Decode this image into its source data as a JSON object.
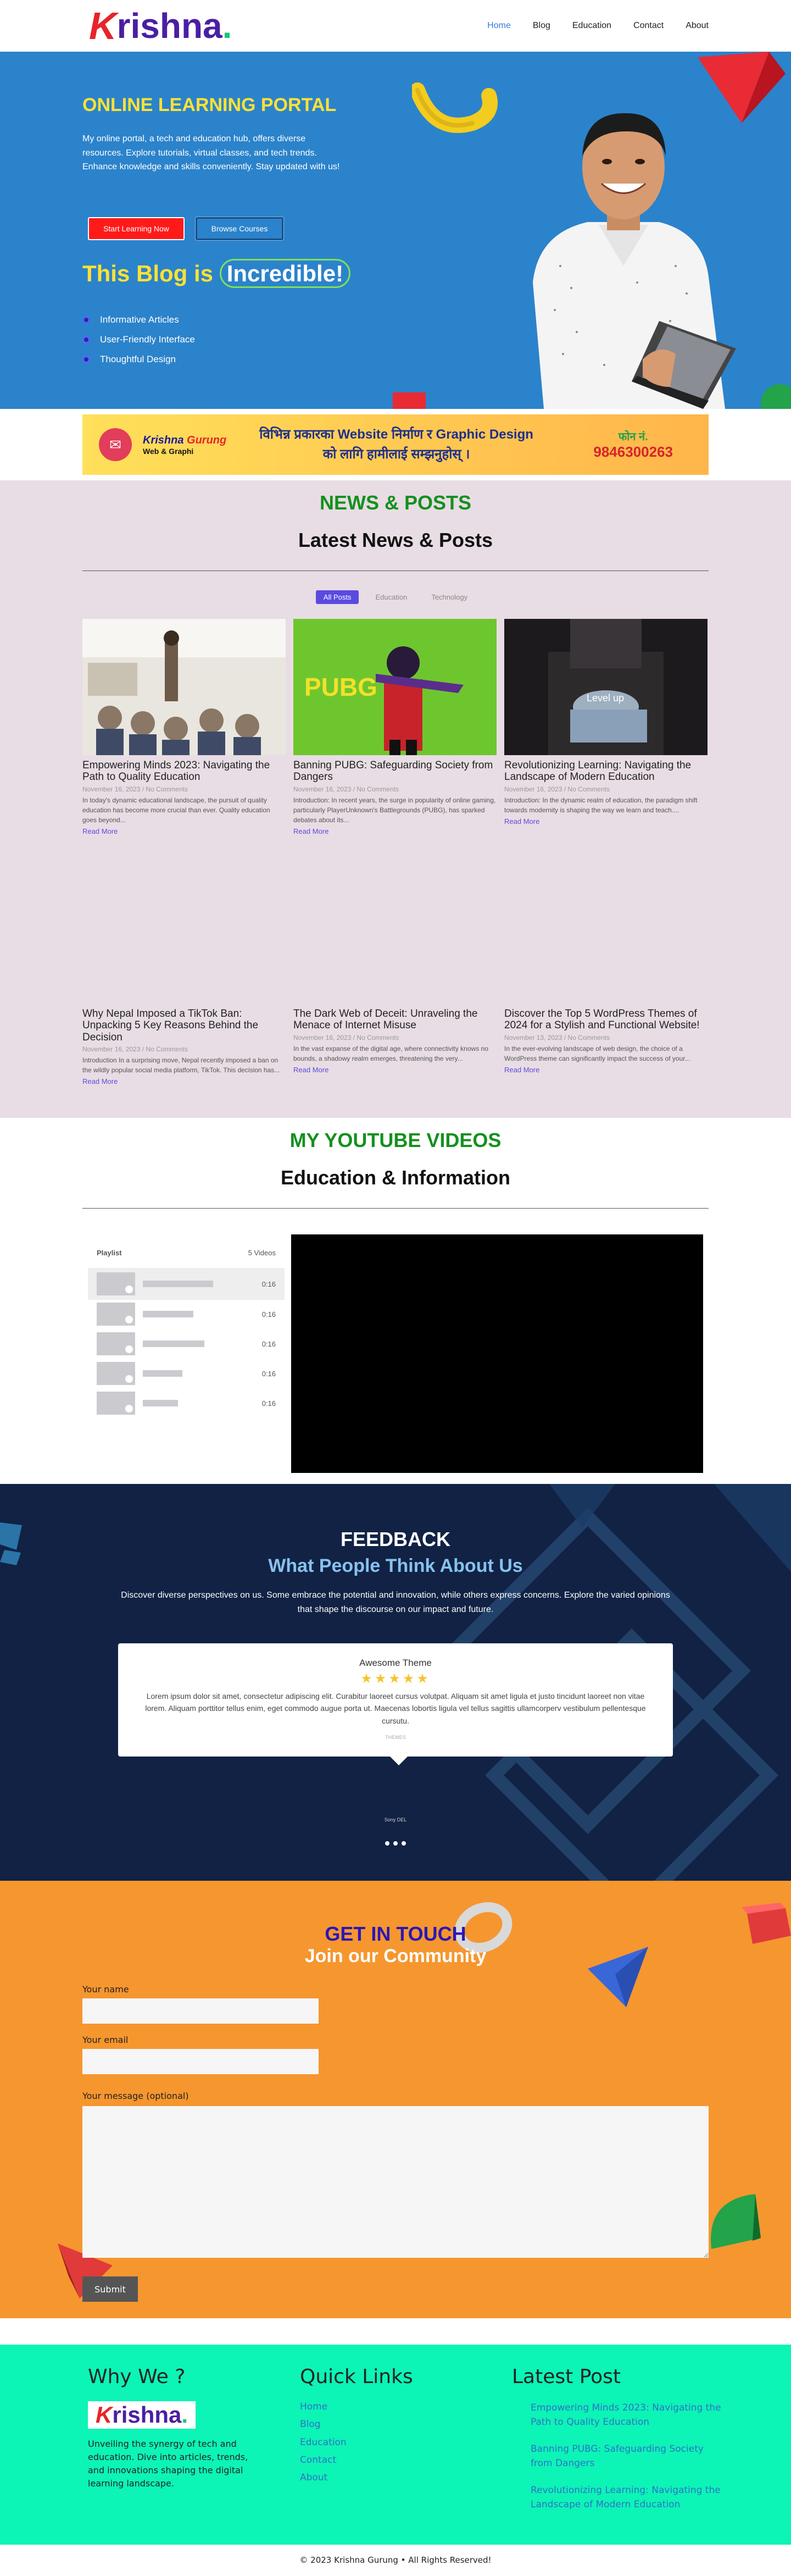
{
  "header": {
    "logo_k": "K",
    "logo_rest": "rishna",
    "logo_dot": ".",
    "nav": [
      "Home",
      "Blog",
      "Education",
      "Contact",
      "About"
    ]
  },
  "hero": {
    "title": "ONLINE LEARNING PORTAL",
    "intro": "My online portal, a tech and education hub, offers diverse resources. Explore tutorials, virtual classes, and tech trends. Enhance knowledge and skills conveniently. Stay updated with us!",
    "btn_primary": "Start Learning Now",
    "btn_secondary": "Browse Courses",
    "blog_prefix": "This Blog is",
    "blog_highlight": "Incredible!",
    "features": [
      "Informative Articles",
      "User-Friendly Interface",
      "Thoughtful Design"
    ]
  },
  "banner": {
    "brand_first": "Krishna",
    "brand_second": "Gurung",
    "brand_sub": "Web & Graphi",
    "line1": "विभिन्न प्रकारका Website निर्माण र Graphic Design",
    "line2": "को लागि हामीलाई सम्झनुहोस् ।",
    "phone_label": "फोन नं.",
    "phone": "9846300263"
  },
  "news": {
    "eyebrow": "NEWS & POSTS",
    "title": "Latest News & Posts",
    "filters": [
      "All Posts",
      "Education",
      "Technology"
    ],
    "read_more": "Read More",
    "posts": [
      {
        "title": "Empowering Minds 2023: Navigating the Path to Quality Education",
        "date": "November 16, 2023",
        "comments": "No Comments",
        "excerpt": "In today's dynamic educational landscape, the pursuit of quality education has become more crucial than ever. Quality education goes beyond..."
      },
      {
        "title": "Banning PUBG: Safeguarding Society from Dangers",
        "date": "November 16, 2023",
        "comments": "No Comments",
        "excerpt": "Introduction: In recent years, the surge in popularity of online gaming, particularly PlayerUnknown's Battlegrounds (PUBG), has sparked debates about its..."
      },
      {
        "title": "Revolutionizing Learning: Navigating the Landscape of Modern Education",
        "date": "November 16, 2023",
        "comments": "No Comments",
        "excerpt": "Introduction: In the dynamic realm of education, the paradigm shift towards modernity is shaping the way we learn and teach...."
      },
      {
        "title": "Why Nepal Imposed a TikTok Ban: Unpacking 5 Key Reasons Behind the Decision",
        "date": "November 16, 2023",
        "comments": "No Comments",
        "excerpt": "Introduction In a surprising move, Nepal recently imposed a ban on the wildly popular social media platform, TikTok. This decision has..."
      },
      {
        "title": "The Dark Web of Deceit: Unraveling the Menace of Internet Misuse",
        "date": "November 16, 2023",
        "comments": "No Comments",
        "excerpt": "In the vast expanse of the digital age, where connectivity knows no bounds, a shadowy realm emerges, threatening the very..."
      },
      {
        "title": "Discover the Top 5 WordPress Themes of 2024 for a Stylish and Functional Website!",
        "date": "November 13, 2023",
        "comments": "No Comments",
        "excerpt": "In the ever-evolving landscape of web design, the choice of a WordPress theme can significantly impact the success of your..."
      }
    ],
    "img_text_pubg": "PUBG",
    "img_text_levelup": "Level up"
  },
  "youtube": {
    "eyebrow": "MY YOUTUBE VIDEOS",
    "title": "Education & Information",
    "playlist_label": "Playlist",
    "video_count": "5 Videos",
    "durations": [
      "0:16",
      "0:16",
      "0:16",
      "0:16",
      "0:16"
    ]
  },
  "feedback": {
    "title": "FEEDBACK",
    "subtitle": "What People Think About Us",
    "description": "Discover diverse perspectives on us. Some embrace the potential and innovation, while others express concerns. Explore the varied opinions that shape the discourse on our impact and future.",
    "card_title": "Awesome Theme",
    "stars": "★★★★★",
    "quote": "Lorem ipsum dolor sit amet, consectetur adipiscing elit. Curabitur laoreet cursus volutpat. Aliquam sit amet ligula et justo tincidunt laoreet non vitae lorem. Aliquam porttitor tellus enim, eget commodo augue porta ut. Maecenas lobortis ligula vel tellus sagittis ullamcorperv vestibulum pellentesque cursutu.",
    "reviewer": "THEMES",
    "author": "Sony DEL"
  },
  "contact": {
    "eyebrow": "GET IN TOUCH",
    "title": "Join our Community",
    "name_label": "Your name",
    "email_label": "Your email",
    "message_label": "Your message (optional)",
    "submit": "Submit"
  },
  "footer": {
    "why_title": "Why We ?",
    "why_text": "Unveiling the synergy of tech and education. Dive into articles, trends, and innovations shaping the digital learning landscape.",
    "links_title": "Quick Links",
    "links": [
      "Home",
      "Blog",
      "Education",
      "Contact",
      "About"
    ],
    "posts_title": "Latest Post",
    "posts": [
      "Empowering Minds 2023: Navigating the Path to Quality Education",
      "Banning PUBG: Safeguarding Society from Dangers",
      "Revolutionizing Learning: Navigating the Landscape of Modern Education"
    ],
    "copyright": "© 2023 Krishna Gurung • All Rights Reserved!"
  },
  "colors": {
    "hero_bg": "#2b83cb",
    "news_bg": "#e8dde4",
    "feedback_bg": "#112244",
    "contact_bg": "#f6962f",
    "footer_bg": "#0cf4b6",
    "accent_purple": "#5a4be0"
  }
}
